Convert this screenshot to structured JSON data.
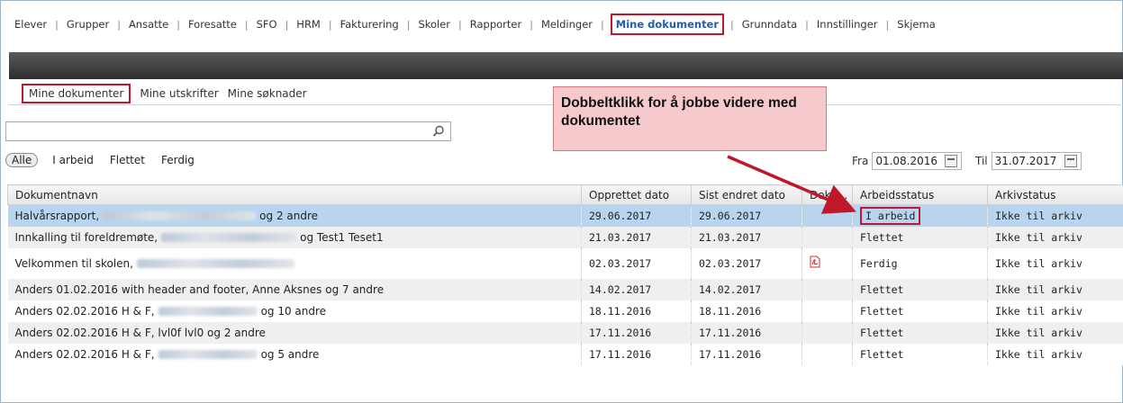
{
  "topnav": {
    "items": [
      "Elever",
      "Grupper",
      "Ansatte",
      "Foresatte",
      "SFO",
      "HRM",
      "Fakturering",
      "Skoler",
      "Rapporter",
      "Meldinger",
      "Mine dokumenter",
      "Grunndata",
      "Innstillinger",
      "Skjema"
    ],
    "active": "Mine dokumenter"
  },
  "subtabs": {
    "items": [
      "Mine dokumenter",
      "Mine utskrifter",
      "Mine søknader"
    ]
  },
  "search": {
    "placeholder": "",
    "value": ""
  },
  "filters": [
    "Alle",
    "I arbeid",
    "Flettet",
    "Ferdig"
  ],
  "dates": {
    "from_label": "Fra",
    "from_value": "01.08.2016",
    "to_label": "Til",
    "to_value": "31.07.2017"
  },
  "callout": {
    "text": "Dobbeltklikk for å jobbe videre med dokumentet"
  },
  "table": {
    "columns": [
      "Dokumentnavn",
      "Opprettet dato",
      "Sist endret dato",
      "Doku...",
      "Arbeidsstatus",
      "Arkivstatus"
    ],
    "rows": [
      {
        "name_pre": "Halvårsrapport,",
        "name_post": "og 2 andre",
        "created": "29.06.2017",
        "changed": "29.06.2017",
        "doc": "",
        "status": "I arbeid",
        "archive": "Ikke til arkiv"
      },
      {
        "name_pre": "Innkalling til foreldremøte,",
        "name_post": "og Test1 Teset1",
        "created": "21.03.2017",
        "changed": "21.03.2017",
        "doc": "",
        "status": "Flettet",
        "archive": "Ikke til arkiv"
      },
      {
        "name_pre": "Velkommen til skolen,",
        "name_post": "",
        "created": "02.03.2017",
        "changed": "02.03.2017",
        "doc": "pdf-icon",
        "status": "Ferdig",
        "archive": "Ikke til arkiv"
      },
      {
        "name_pre": "Anders 01.02.2016 with header and footer, Anne Aksnes og 7 andre",
        "name_post": "",
        "created": "14.02.2017",
        "changed": "14.02.2017",
        "doc": "",
        "status": "Flettet",
        "archive": "Ikke til arkiv"
      },
      {
        "name_pre": "Anders 02.02.2016 H & F,",
        "name_post": "og 10 andre",
        "created": "18.11.2016",
        "changed": "18.11.2016",
        "doc": "",
        "status": "Flettet",
        "archive": "Ikke til arkiv"
      },
      {
        "name_pre": "Anders 02.02.2016 H & F, lvl0f lvl0 og 2 andre",
        "name_post": "",
        "created": "17.11.2016",
        "changed": "17.11.2016",
        "doc": "",
        "status": "Flettet",
        "archive": "Ikke til arkiv"
      },
      {
        "name_pre": "Anders 02.02.2016 H & F,",
        "name_post": "og 5 andre",
        "created": "17.11.2016",
        "changed": "17.11.2016",
        "doc": "",
        "status": "Flettet",
        "archive": "Ikke til arkiv"
      }
    ]
  },
  "colors": {
    "highlight_red": "#c0182b",
    "selected_row": "#b8d4ee",
    "active_nav": "#1f5ea8",
    "callout_bg": "#f6c9cd"
  }
}
